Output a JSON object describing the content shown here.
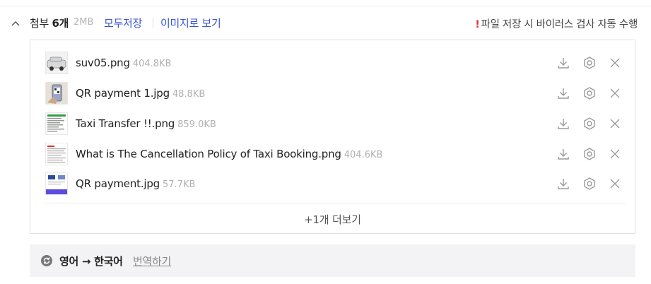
{
  "attachments": {
    "title": "첨부",
    "count": "6개",
    "total_size": "2MB",
    "save_all_label": "모두저장",
    "view_as_image_label": "이미지로 보기",
    "virus_scan_mark": "!",
    "virus_scan_notice": "파일 저장 시 바이러스 검사 자동 수행",
    "files": [
      {
        "name": "suv05.png",
        "size": "404.8KB"
      },
      {
        "name": "QR payment 1.jpg",
        "size": "48.8KB"
      },
      {
        "name": "Taxi Transfer !!.png",
        "size": "859.0KB"
      },
      {
        "name": "What is The Cancellation Policy of Taxi Booking.png",
        "size": "404.6KB"
      },
      {
        "name": "QR payment.jpg",
        "size": "57.7KB"
      }
    ],
    "more_label": "+1개 더보기"
  },
  "translation": {
    "languages": "영어 → 한국어",
    "action_label": "번역하기"
  },
  "colors": {
    "link": "#3a55d8",
    "warning": "#e03131",
    "icon": "#9a9a9a"
  }
}
